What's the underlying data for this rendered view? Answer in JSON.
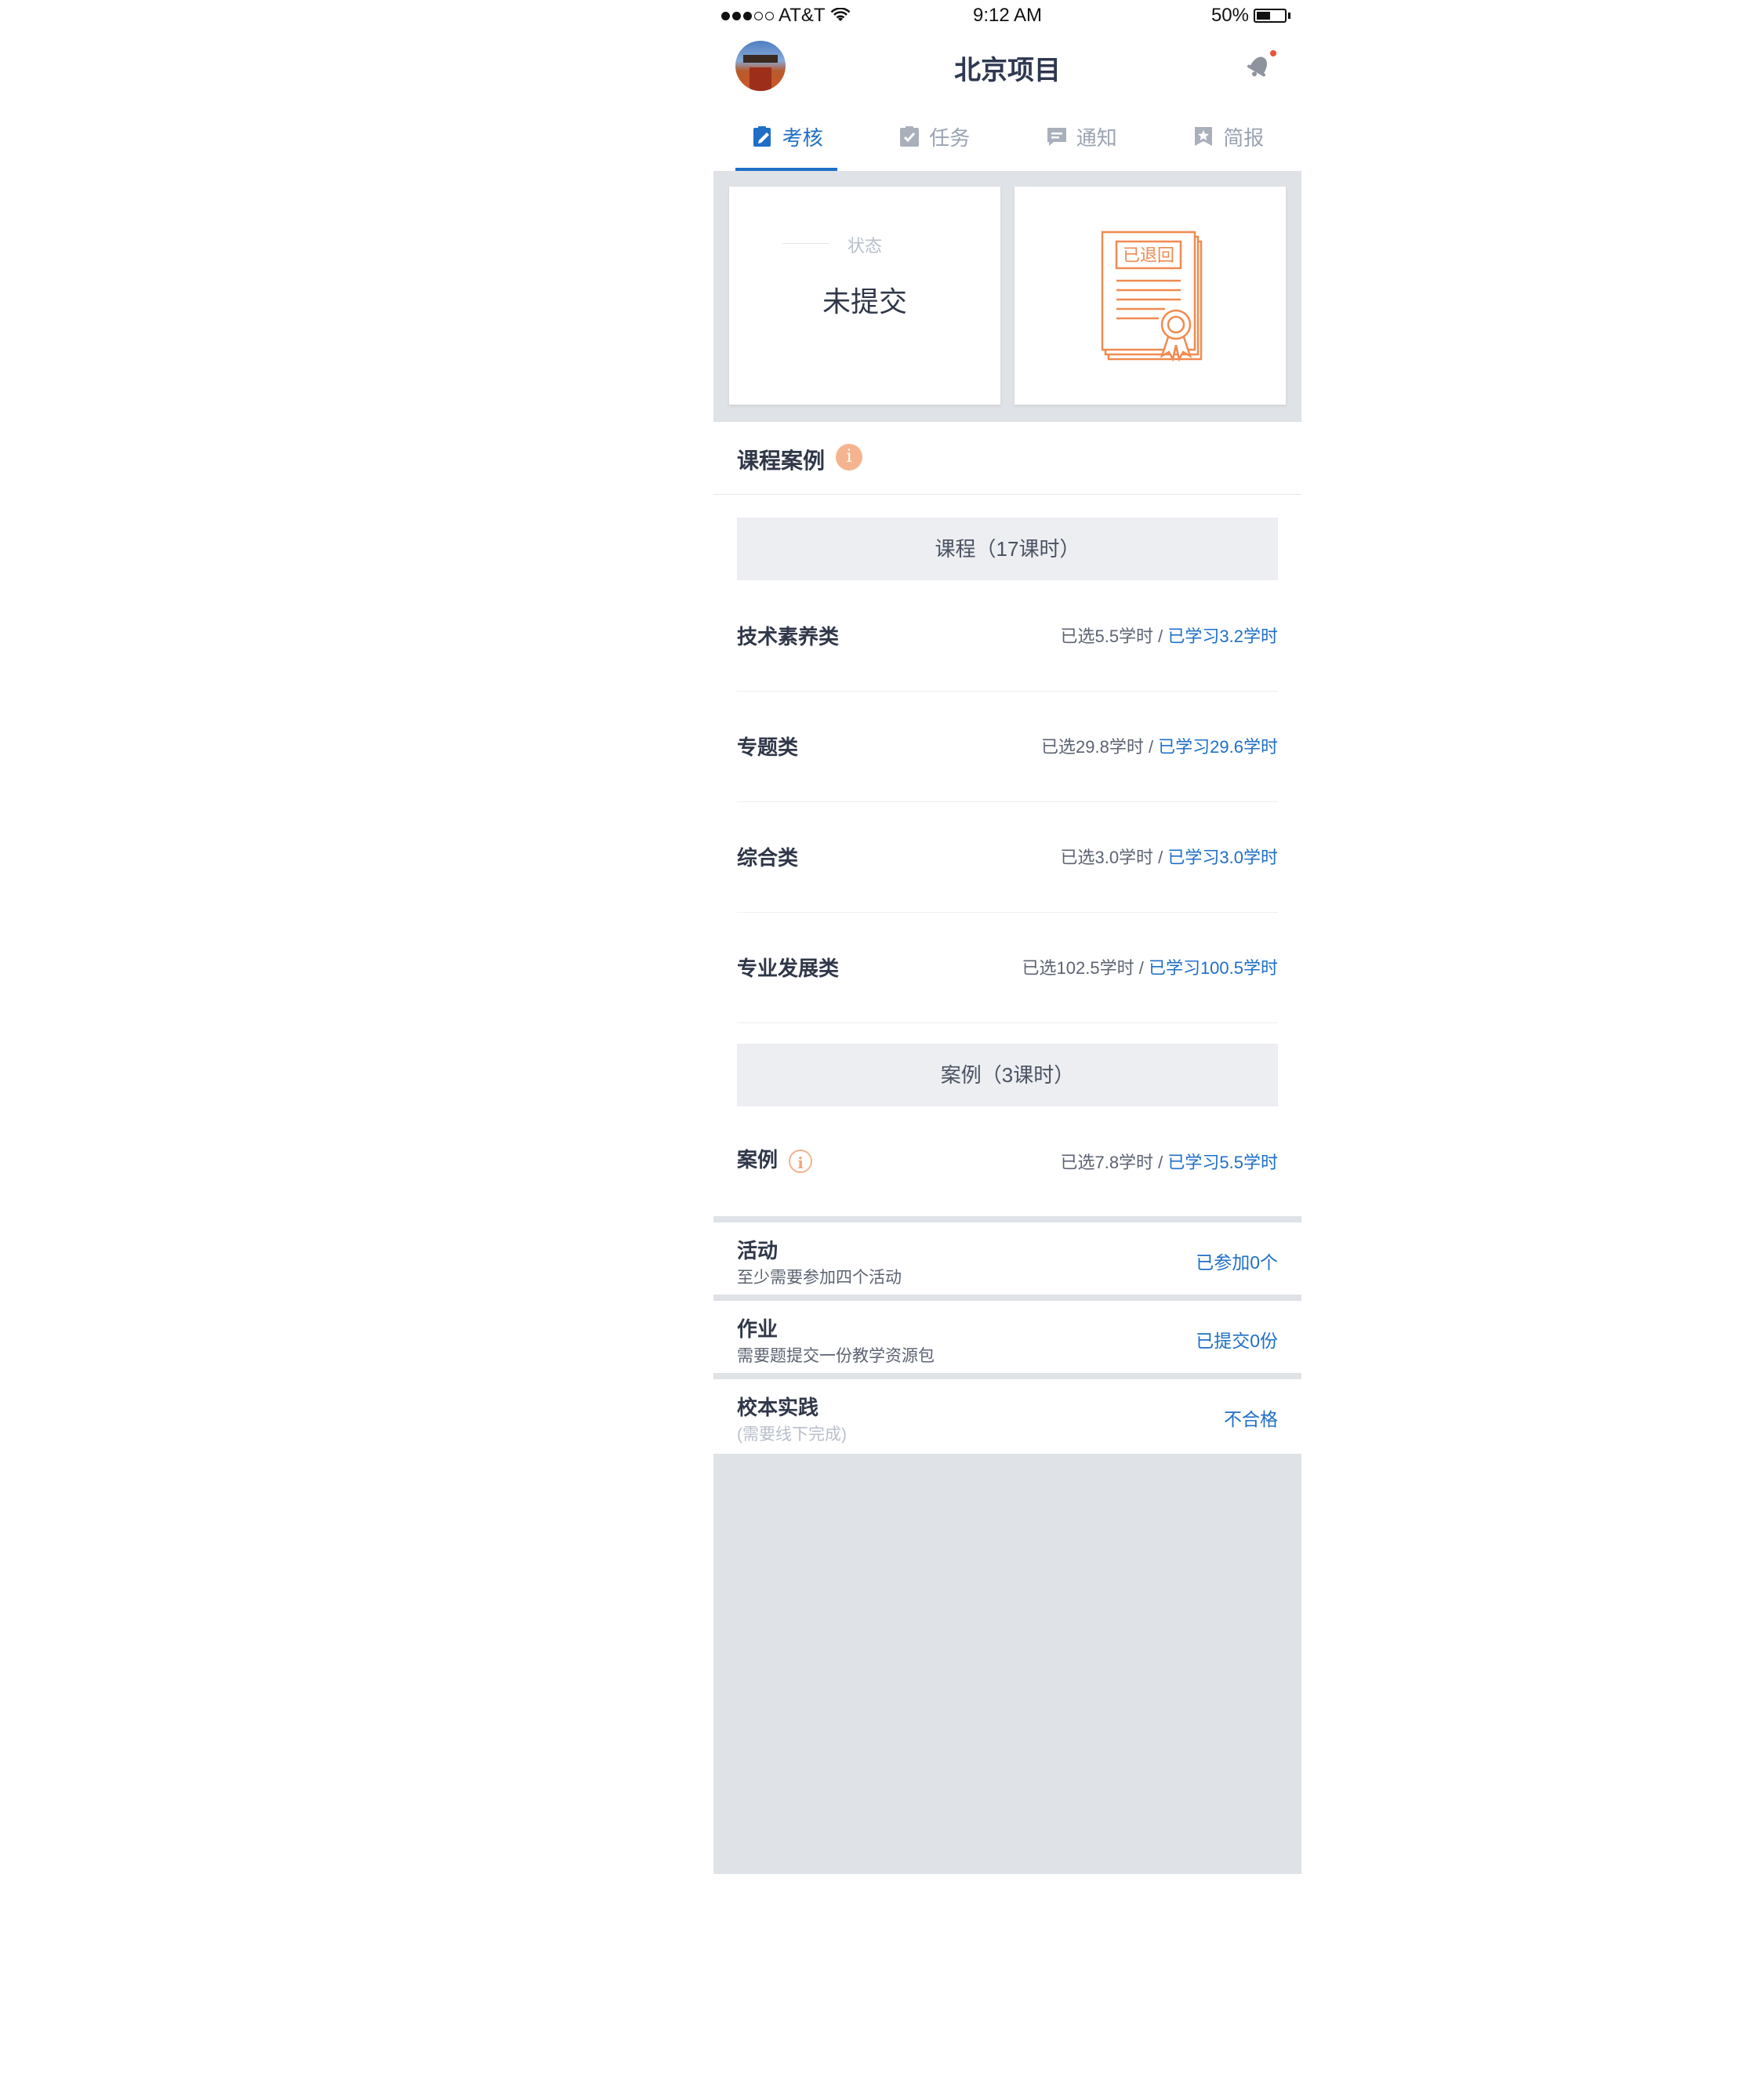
{
  "status_bar": {
    "carrier": "AT&T",
    "time": "9:12 AM",
    "battery": "50%",
    "battery_level": 0.5
  },
  "nav": {
    "title": "北京项目"
  },
  "tabs": [
    {
      "label": "考核",
      "icon": "clipboard-edit-icon",
      "active": true
    },
    {
      "label": "任务",
      "icon": "clipboard-check-icon",
      "active": false
    },
    {
      "label": "通知",
      "icon": "message-icon",
      "active": false
    },
    {
      "label": "简报",
      "icon": "bookmark-star-icon",
      "active": false
    }
  ],
  "status_card": {
    "label": "状态",
    "value": "未提交"
  },
  "certificate_card": {
    "stamp": "已退回",
    "icon": "certificate-icon"
  },
  "section": {
    "title": "课程案例"
  },
  "course_group": {
    "header": "课程（17课时）",
    "rows": [
      {
        "name": "技术素养类",
        "selected": "已选5.5学时",
        "sep": " / ",
        "learned": "已学习3.2学时"
      },
      {
        "name": "专题类",
        "selected": "已选29.8学时",
        "sep": " / ",
        "learned": "已学习29.6学时"
      },
      {
        "name": "综合类",
        "selected": "已选3.0学时",
        "sep": " / ",
        "learned": "已学习3.0学时"
      },
      {
        "name": "专业发展类",
        "selected": "已选102.5学时",
        "sep": " / ",
        "learned": "已学习100.5学时"
      }
    ]
  },
  "case_group": {
    "header": "案例（3课时）",
    "row": {
      "name": "案例",
      "selected": "已选7.8学时",
      "sep": " / ",
      "learned": "已学习5.5学时"
    }
  },
  "items": [
    {
      "title": "活动",
      "subtitle": "至少需要参加四个活动",
      "value": "已参加0个"
    },
    {
      "title": "作业",
      "subtitle": "需要题提交一份教学资源包",
      "value": "已提交0份"
    },
    {
      "title": "校本实践",
      "subtitle": "(需要线下完成)",
      "value": "不合格"
    }
  ],
  "colors": {
    "accent": "#1f6fc6",
    "orange": "#f08a50",
    "gray_bg": "#dfe2e6"
  }
}
